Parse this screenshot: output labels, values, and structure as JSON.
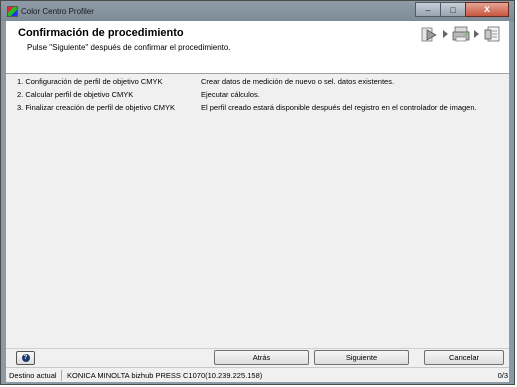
{
  "window": {
    "title": "Color Centro Profiler",
    "controls": {
      "minimize": "–",
      "maximize": "□",
      "close": "x"
    }
  },
  "header": {
    "title": "Confirmación de procedimiento",
    "subtitle": "Pulse \"Siguiente\" después de confirmar el procedimiento."
  },
  "steps": [
    {
      "label": "1. Configuración de perfil de objetivo CMYK",
      "description": "Crear datos de medición de nuevo o sel. datos existentes."
    },
    {
      "label": "2. Calcular perfil de objetivo CMYK",
      "description": "Ejecutar cálculos."
    },
    {
      "label": "3. Finalizar creación de perfil de objetivo CMYK",
      "description": "El perfil creado estará disponible después del registro en el controlador de imagen."
    }
  ],
  "buttons": {
    "help": "?",
    "back": "Atrás",
    "next": "Siguiente",
    "cancel": "Cancelar"
  },
  "status": {
    "label": "Destino actual",
    "value": "KONICA MINOLTA bizhub PRESS C1070(10.239.225.158)",
    "count": "0/3"
  },
  "icons": [
    "play-step-icon",
    "printer-step-icon",
    "document-step-icon"
  ]
}
